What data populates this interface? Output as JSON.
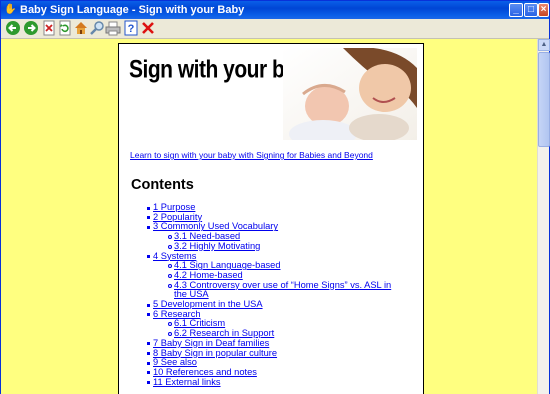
{
  "window": {
    "title": "Baby Sign Language  - Sign with your Baby",
    "minimize_glyph": "_",
    "maximize_glyph": "□",
    "close_glyph": "×"
  },
  "toolbar": {
    "items": [
      {
        "name": "back-icon",
        "color": "#2e9a2e"
      },
      {
        "name": "forward-icon",
        "color": "#2e9a2e"
      },
      {
        "name": "stop-icon",
        "color": "#cc2222"
      },
      {
        "name": "refresh-icon",
        "color": "#2e9a2e"
      },
      {
        "name": "home-icon",
        "color": "#d47a1f"
      },
      {
        "name": "search-icon",
        "color": "#6688aa"
      },
      {
        "name": "print-icon",
        "color": "#888888"
      },
      {
        "name": "help-icon",
        "color": "#2255cc"
      },
      {
        "name": "close-icon",
        "color": "#dd1111"
      }
    ]
  },
  "banner": {
    "title": "Sign with your baby!"
  },
  "signing_link": "Learn to sign with your baby with Signing for Babies and Beyond",
  "contents_heading": "Contents",
  "toc": [
    {
      "label": "1 Purpose",
      "level": 1
    },
    {
      "label": "2 Popularity",
      "level": 1
    },
    {
      "label": "3 Commonly Used Vocabulary",
      "level": 1
    },
    {
      "label": "3.1 Need-based",
      "level": 2
    },
    {
      "label": "3.2 Highly Motivating",
      "level": 2
    },
    {
      "label": "4 Systems",
      "level": 1
    },
    {
      "label": "4.1 Sign Language-based",
      "level": 2
    },
    {
      "label": "4.2 Home-based",
      "level": 2
    },
    {
      "label": "4.3 Controversy over use of “Home Signs” vs. ASL in",
      "label_cont": "the USA",
      "level": 2
    },
    {
      "label": "5 Development in the USA",
      "level": 1
    },
    {
      "label": "6 Research",
      "level": 1
    },
    {
      "label": "6.1 Criticism",
      "level": 2
    },
    {
      "label": "6.2 Research in Support",
      "level": 2
    },
    {
      "label": "7 Baby Sign in Deaf families",
      "level": 1
    },
    {
      "label": "8 Baby Sign in popular culture",
      "level": 1
    },
    {
      "label": "9 See also",
      "level": 1
    },
    {
      "label": "10 References and notes",
      "level": 1
    },
    {
      "label": "11 External links",
      "level": 1
    }
  ],
  "colors": {
    "background": "#ffff80",
    "link": "#0000ee",
    "titlebar": "#0a5fe8"
  }
}
